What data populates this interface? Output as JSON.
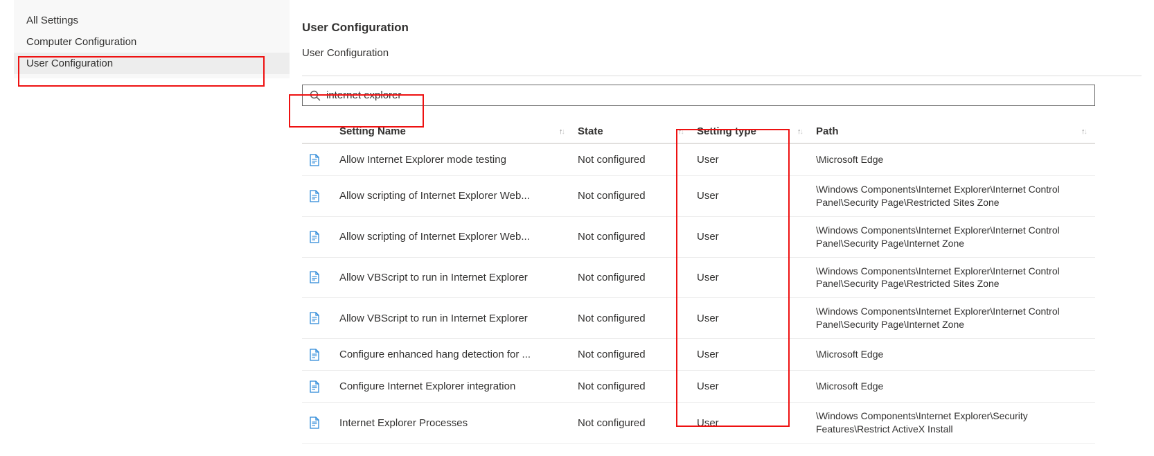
{
  "sidebar": {
    "items": [
      {
        "label": "All Settings",
        "selected": false
      },
      {
        "label": "Computer Configuration",
        "selected": false
      },
      {
        "label": "User Configuration",
        "selected": true
      }
    ]
  },
  "header": {
    "title": "User Configuration",
    "subtitle": "User Configuration"
  },
  "search": {
    "value": "internet explorer"
  },
  "table": {
    "columns": {
      "name": "Setting Name",
      "state": "State",
      "type": "Setting type",
      "path": "Path"
    },
    "rows": [
      {
        "name": "Allow Internet Explorer mode testing",
        "state": "Not configured",
        "type": "User",
        "path": "\\Microsoft Edge"
      },
      {
        "name": "Allow scripting of Internet Explorer Web...",
        "state": "Not configured",
        "type": "User",
        "path": "\\Windows Components\\Internet Explorer\\Internet Control Panel\\Security Page\\Restricted Sites Zone"
      },
      {
        "name": "Allow scripting of Internet Explorer Web...",
        "state": "Not configured",
        "type": "User",
        "path": "\\Windows Components\\Internet Explorer\\Internet Control Panel\\Security Page\\Internet Zone"
      },
      {
        "name": "Allow VBScript to run in Internet Explorer",
        "state": "Not configured",
        "type": "User",
        "path": "\\Windows Components\\Internet Explorer\\Internet Control Panel\\Security Page\\Restricted Sites Zone"
      },
      {
        "name": "Allow VBScript to run in Internet Explorer",
        "state": "Not configured",
        "type": "User",
        "path": "\\Windows Components\\Internet Explorer\\Internet Control Panel\\Security Page\\Internet Zone"
      },
      {
        "name": "Configure enhanced hang detection for ...",
        "state": "Not configured",
        "type": "User",
        "path": "\\Microsoft Edge"
      },
      {
        "name": "Configure Internet Explorer integration",
        "state": "Not configured",
        "type": "User",
        "path": "\\Microsoft Edge"
      },
      {
        "name": "Internet Explorer Processes",
        "state": "Not configured",
        "type": "User",
        "path": "\\Windows Components\\Internet Explorer\\Security Features\\Restrict ActiveX Install"
      }
    ]
  }
}
